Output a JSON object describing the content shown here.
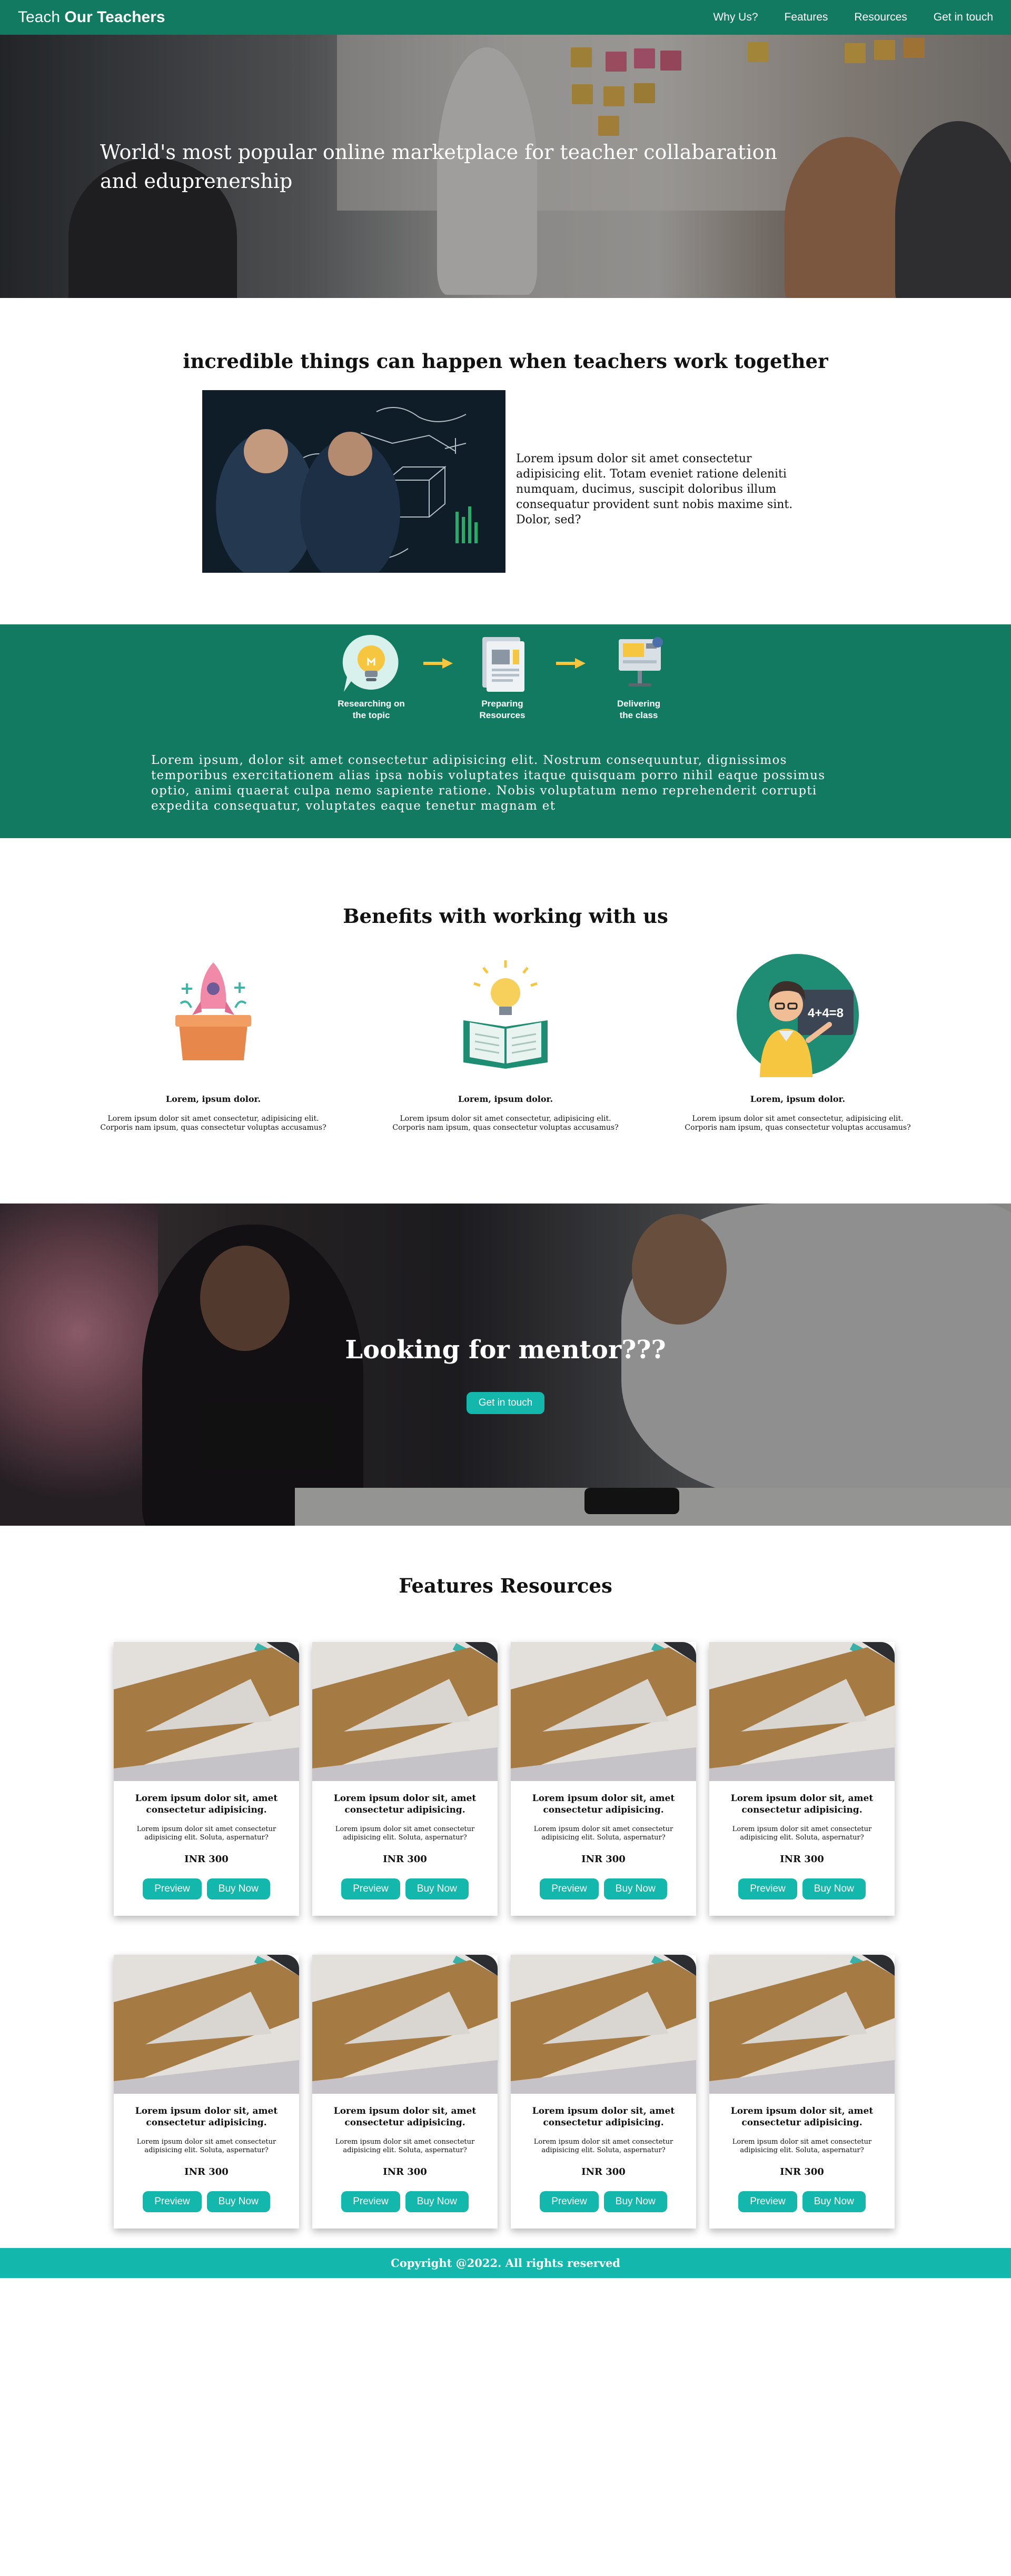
{
  "nav": {
    "brand_prefix": "Teach",
    "brand_bold": "Our Teachers",
    "links": [
      "Why Us?",
      "Features",
      "Resources",
      "Get in touch"
    ]
  },
  "hero": {
    "title": "World's most popular online marketplace for teacher collabaration and eduprenership"
  },
  "intro": {
    "title": "incredible things can happen when teachers work together",
    "text": "Lorem ipsum dolor sit amet consectetur adipisicing elit. Totam eveniet ratione deleniti numquam, ducimus, suscipit doloribus illum consequatur provident sunt nobis maxime sint. Dolor, sed?"
  },
  "process": {
    "steps": [
      {
        "label_line1": "Researching on",
        "label_line2": "the topic",
        "icon": "lightbulb-icon"
      },
      {
        "label_line1": "Preparing",
        "label_line2": "Resources",
        "icon": "document-icon"
      },
      {
        "label_line1": "Delivering",
        "label_line2": "the class",
        "icon": "presentation-icon"
      }
    ],
    "text": "Lorem ipsum, dolor sit amet consectetur adipisicing elit. Nostrum consequuntur, dignissimos temporibus exercitationem alias ipsa nobis voluptates itaque quisquam porro nihil eaque possimus optio, animi quaerat culpa nemo sapiente ratione. Nobis voluptatum nemo reprehenderit corrupti expedita consequatur, voluptates eaque tenetur magnam et"
  },
  "benefits": {
    "title": "Benefits with working with us",
    "items": [
      {
        "icon": "rocket-icon",
        "heading": "Lorem, ipsum dolor.",
        "body": "Lorem ipsum dolor sit amet consectetur, adipisicing elit. Corporis nam ipsum, quas consectetur voluptas accusamus?"
      },
      {
        "icon": "book-bulb-icon",
        "heading": "Lorem, ipsum dolor.",
        "body": "Lorem ipsum dolor sit amet consectetur, adipisicing elit. Corporis nam ipsum, quas consectetur voluptas accusamus?"
      },
      {
        "icon": "teacher-icon",
        "heading": "Lorem, ipsum dolor.",
        "body": "Lorem ipsum dolor sit amet consectetur, adipisicing elit. Corporis nam ipsum, quas consectetur voluptas accusamus?"
      }
    ],
    "board_text": "4+4=8"
  },
  "mentor": {
    "title": "Looking for mentor???",
    "button": "Get in touch"
  },
  "resources": {
    "title": "Features Resources",
    "card_title": "Lorem ipsum dolor sit, amet consectetur adipisicing.",
    "card_desc": "Lorem ipsum dolor sit amet consectetur adipisicing elit. Soluta, aspernatur?",
    "price": "INR 300",
    "preview_label": "Preview",
    "buy_label": "Buy Now"
  },
  "footer": {
    "text": "Copyright @2022. All rights reserved"
  },
  "colors": {
    "primary_green": "#127a60",
    "accent_teal": "#13b7ab"
  }
}
